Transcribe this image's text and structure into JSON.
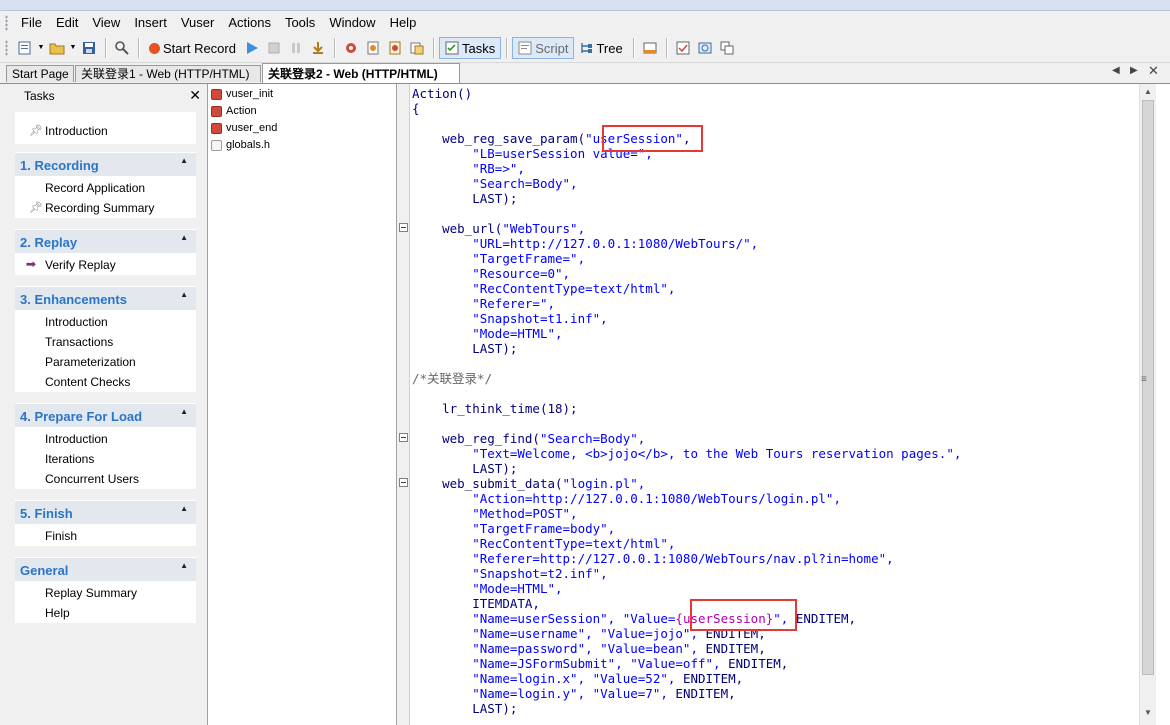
{
  "menu": [
    "File",
    "Edit",
    "View",
    "Insert",
    "Vuser",
    "Actions",
    "Tools",
    "Window",
    "Help"
  ],
  "toolbar": {
    "start_record": "Start Record",
    "tasks": "Tasks",
    "script": "Script",
    "tree": "Tree"
  },
  "tabs": {
    "start_page": "Start Page",
    "tab1": "关联登录1 - Web (HTTP/HTML)",
    "tab2": "关联登录2 - Web (HTTP/HTML)"
  },
  "tasks_pane": {
    "title": "Tasks",
    "intro": "Introduction",
    "sections": [
      {
        "title": "1. Recording",
        "items": [
          "Record Application",
          "Recording Summary"
        ]
      },
      {
        "title": "2. Replay",
        "items": [
          "Verify Replay"
        ]
      },
      {
        "title": "3. Enhancements",
        "items": [
          "Introduction",
          "Transactions",
          "Parameterization",
          "Content Checks"
        ]
      },
      {
        "title": "4. Prepare For Load",
        "items": [
          "Introduction",
          "Iterations",
          "Concurrent Users"
        ]
      },
      {
        "title": "5. Finish",
        "items": [
          "Finish"
        ]
      },
      {
        "title": "General",
        "items": [
          "Replay Summary",
          "Help"
        ]
      }
    ]
  },
  "tree": [
    "vuser_init",
    "Action",
    "vuser_end",
    "globals.h"
  ],
  "code": {
    "l0": "Action()",
    "l1": "{",
    "l3a": "web_reg_save_param(",
    "l3b": "\"userSession\"",
    "l3c": ",",
    "l4": "\"LB=userSession value=\",",
    "l5": "\"RB=>\",",
    "l6": "\"Search=Body\",",
    "l7": "LAST);",
    "l9a": "web_url(",
    "l9b": "\"WebTours\",",
    "l10": "\"URL=http://127.0.0.1:1080/WebTours/\",",
    "l11": "\"TargetFrame=\",",
    "l12": "\"Resource=0\",",
    "l13": "\"RecContentType=text/html\",",
    "l14": "\"Referer=\",",
    "l15": "\"Snapshot=t1.inf\",",
    "l16": "\"Mode=HTML\",",
    "l17": "LAST);",
    "l19": "/*关联登录*/",
    "l21a": "lr_think_time(",
    "l21b": "18",
    "l21c": ");",
    "l23a": "web_reg_find(",
    "l23b": "\"Search=Body\",",
    "l24": "\"Text=Welcome, <b>jojo</b>, to the Web Tours reservation pages.\",",
    "l25": "LAST);",
    "l26a": "web_submit_data(",
    "l26b": "\"login.pl\",",
    "l27": "\"Action=http://127.0.0.1:1080/WebTours/login.pl\",",
    "l28": "\"Method=POST\",",
    "l29": "\"TargetFrame=body\",",
    "l30": "\"RecContentType=text/html\",",
    "l31": "\"Referer=http://127.0.0.1:1080/WebTours/nav.pl?in=home\",",
    "l32": "\"Snapshot=t2.inf\",",
    "l33": "\"Mode=HTML\",",
    "l34": "ITEMDATA,",
    "l35a": "\"Name=userSession\", \"Value=",
    "l35b": "{userSession}",
    "l35c": "\", ",
    "l35d": "ENDITEM,",
    "l36a": "\"Name=username\", \"Value=jojo\", ",
    "l36b": "ENDITEM,",
    "l37a": "\"Name=password\", \"Value=bean\", ",
    "l37b": "ENDITEM,",
    "l38a": "\"Name=JSFormSubmit\", \"Value=off\", ",
    "l38b": "ENDITEM,",
    "l39a": "\"Name=login.x\", \"Value=52\", ",
    "l39b": "ENDITEM,",
    "l40a": "\"Name=login.y\", \"Value=7\", ",
    "l40b": "ENDITEM,",
    "l41": "LAST);"
  },
  "colors": {
    "accent": "#2a75c9",
    "highlight": "#e53935",
    "record": "#e8531f"
  }
}
